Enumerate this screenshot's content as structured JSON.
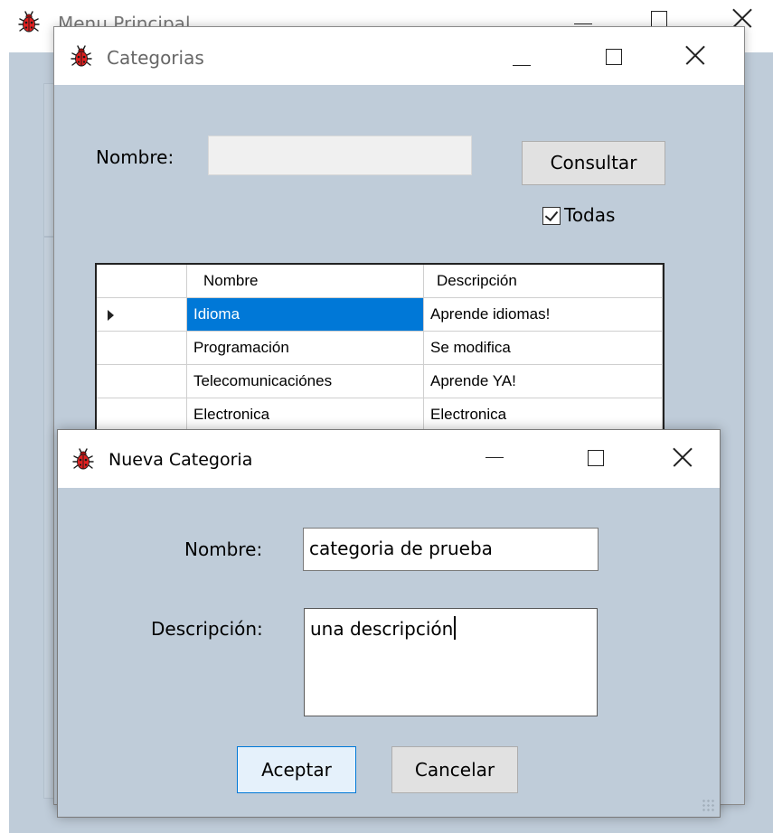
{
  "main_window": {
    "title": "Menu Principal"
  },
  "categorias_window": {
    "title": "Categorias",
    "nombre_label": "Nombre:",
    "nombre_value": "",
    "consultar_button": "Consultar",
    "todas_checkbox_label": "Todas",
    "todas_checked": true,
    "grid": {
      "columns": [
        "Nombre",
        "Descripción"
      ],
      "rows": [
        {
          "nombre": "Idioma",
          "descripcion": "Aprende idiomas!",
          "selected": true
        },
        {
          "nombre": "Programación",
          "descripcion": "Se modifica",
          "selected": false
        },
        {
          "nombre": "Telecomunicaciónes",
          "descripcion": "Aprende YA!",
          "selected": false
        },
        {
          "nombre": "Electronica",
          "descripcion": "Electronica",
          "selected": false
        }
      ]
    }
  },
  "nueva_categoria_window": {
    "title": "Nueva Categoria",
    "nombre_label": "Nombre:",
    "nombre_value": "categoria de prueba",
    "descripcion_label": "Descripción:",
    "descripcion_value": "una descripción",
    "aceptar_button": "Aceptar",
    "cancelar_button": "Cancelar"
  },
  "icons": {
    "app_icon": "red-bug-icon",
    "minimize": "minimize-icon",
    "maximize": "maximize-icon",
    "close": "close-icon"
  },
  "colors": {
    "form_background": "#bfccd9",
    "selection": "#0078d7",
    "app_icon_red": "#e02020"
  }
}
